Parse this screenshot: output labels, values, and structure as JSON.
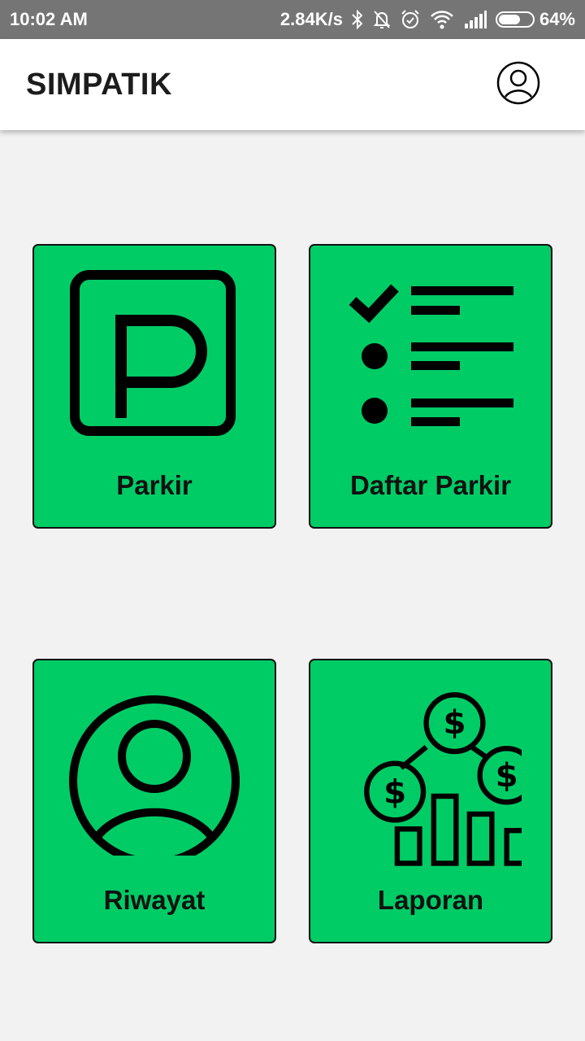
{
  "status_bar": {
    "time": "10:02 AM",
    "network_speed": "2.84K/s",
    "battery_percent": "64%",
    "battery_level": 0.64,
    "icons": [
      "bluetooth-icon",
      "notifications-off-icon",
      "alarm-icon",
      "wifi-icon",
      "cell-signal-icon",
      "battery-icon"
    ]
  },
  "app_bar": {
    "title": "SIMPATIK",
    "profile_icon": "account-circle-icon"
  },
  "menu": {
    "items": [
      {
        "label": "Parkir",
        "icon": "parking-icon"
      },
      {
        "label": "Daftar Parkir",
        "icon": "checklist-icon"
      },
      {
        "label": "Riwayat",
        "icon": "user-circle-icon"
      },
      {
        "label": "Laporan",
        "icon": "finance-report-icon"
      }
    ]
  },
  "colors": {
    "tile_background": "#00cc66",
    "status_bar": "#757575",
    "app_bar": "#ffffff",
    "page_background": "#f2f2f2"
  }
}
